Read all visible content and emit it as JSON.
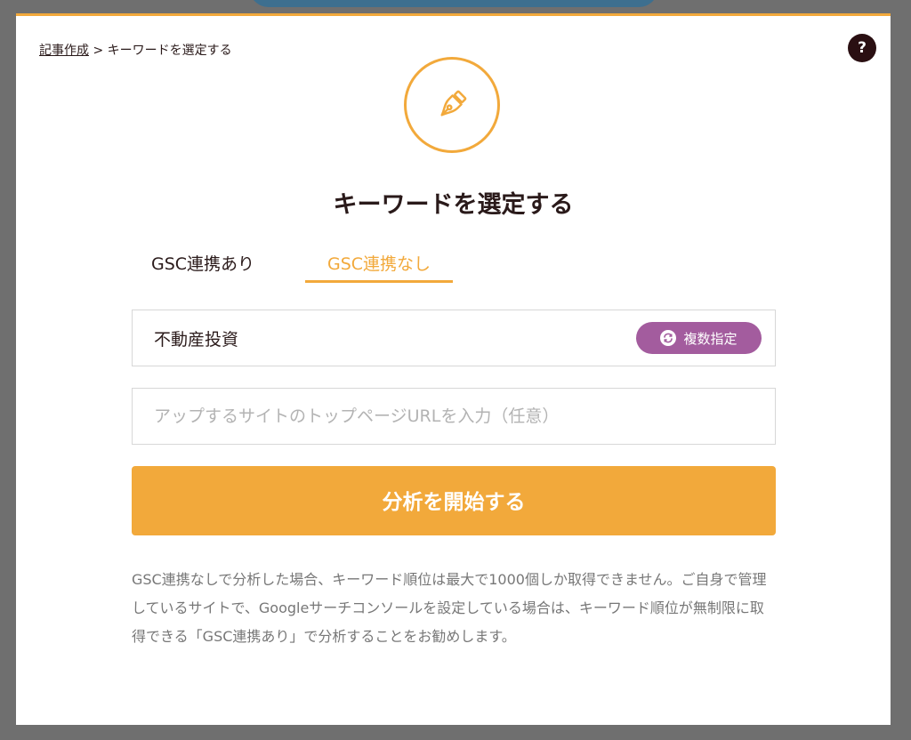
{
  "breadcrumb": {
    "parent": "記事作成",
    "separator": " > ",
    "current": "キーワードを選定する"
  },
  "help": {
    "label": "?",
    "icon": "question-icon"
  },
  "header_icon": "pen-nib-icon",
  "title": "キーワードを選定する",
  "tabs": [
    {
      "label": "GSC連携あり",
      "active": false
    },
    {
      "label": "GSC連携なし",
      "active": true
    }
  ],
  "keyword_input": {
    "value": "不動産投資",
    "multi_button_label": "複数指定",
    "multi_button_icon": "swap-icon"
  },
  "url_input": {
    "value": "",
    "placeholder": "アップするサイトのトップページURLを入力（任意）"
  },
  "start_button": {
    "label": "分析を開始する"
  },
  "note": "GSC連携なしで分析した場合、キーワード順位は最大で1000個しか取得できません。ご自身で管理しているサイトで、Googleサーチコンソールを設定している場合は、キーワード順位が無制限に取得できる「GSC連携あり」で分析することをお勧めします。",
  "colors": {
    "accent": "#f2a93b",
    "multi_button": "#a35c9e",
    "text_dark": "#2a1a1a",
    "text_muted": "#777777"
  }
}
